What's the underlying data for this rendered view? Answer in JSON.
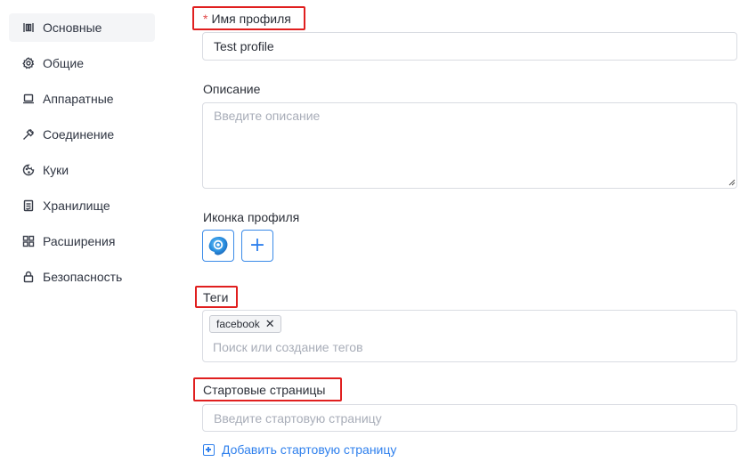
{
  "sidebar": {
    "items": [
      {
        "label": "Основные",
        "icon": "sliders-icon",
        "active": true
      },
      {
        "label": "Общие",
        "icon": "gear-icon",
        "active": false
      },
      {
        "label": "Аппаратные",
        "icon": "laptop-icon",
        "active": false
      },
      {
        "label": "Соединение",
        "icon": "plug-icon",
        "active": false
      },
      {
        "label": "Куки",
        "icon": "cookie-icon",
        "active": false
      },
      {
        "label": "Хранилище",
        "icon": "storage-icon",
        "active": false
      },
      {
        "label": "Расширения",
        "icon": "extensions-icon",
        "active": false
      },
      {
        "label": "Безопасность",
        "icon": "lock-icon",
        "active": false
      }
    ]
  },
  "form": {
    "profile_name": {
      "required_mark": "*",
      "label": "Имя профиля",
      "value": "Test profile"
    },
    "description": {
      "label": "Описание",
      "placeholder": "Введите описание"
    },
    "profile_icon": {
      "label": "Иконка профиля"
    },
    "tags": {
      "label": "Теги",
      "items": [
        "facebook"
      ],
      "placeholder": "Поиск или создание тегов"
    },
    "start_pages": {
      "label": "Стартовые страницы",
      "placeholder": "Введите стартовую страницу",
      "add_label": "Добавить стартовую страницу"
    }
  },
  "colors": {
    "accent": "#2f80ed",
    "highlight": "#e01f1f",
    "required": "#e14a4a"
  }
}
